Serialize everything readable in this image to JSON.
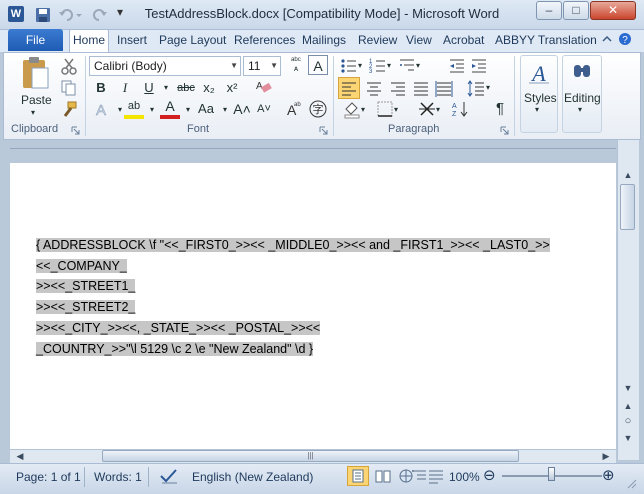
{
  "window": {
    "title": "TestAddressBlock.docx [Compatibility Mode]  -  Microsoft Word",
    "min_label": "–",
    "max_label": "□",
    "close_label": "✕"
  },
  "qat": {
    "word_logo_label": "W",
    "dropdown_label": "▾"
  },
  "tabs": {
    "file": "File",
    "home": "Home",
    "items": [
      "Insert",
      "Page Layout",
      "References",
      "Mailings",
      "Review",
      "View",
      "Acrobat",
      "ABBYY Translation"
    ]
  },
  "ribbon": {
    "clipboard": {
      "label": "Clipboard",
      "paste": "Paste"
    },
    "font": {
      "label": "Font",
      "font_name": "Calibri (Body)",
      "font_size": "11",
      "bold": "B",
      "italic": "I",
      "underline": "U",
      "strikethrough": "abc",
      "subscript": "x₂",
      "superscript": "x²",
      "grow": "A˄",
      "shrink": "A˅",
      "change_case": "Aa",
      "font_color_glyph": "A",
      "highlight_glyph": "ab"
    },
    "paragraph": {
      "label": "Paragraph",
      "pilcrow": "¶"
    },
    "styles": {
      "label": "Styles"
    },
    "editing": {
      "label": "Editing"
    }
  },
  "document": {
    "lines": [
      "{ ADDRESSBLOCK \\f \"<<_FIRST0_>><< _MIDDLE0_>><< and _FIRST1_>><< _LAST0_>>",
      "<<_COMPANY_",
      ">><<_STREET1_",
      ">><<_STREET2_",
      ">><<_CITY_>><<, _STATE_>><< _POSTAL_>><<",
      "_COUNTRY_>>\"\\l 5129 \\c 2 \\e \"New Zealand\" \\d }"
    ]
  },
  "status": {
    "page": "Page: 1 of 1",
    "words": "Words: 1",
    "language": "English (New Zealand)",
    "zoom": "100%",
    "zoom_out": "⊖",
    "zoom_in": "⊕"
  },
  "colors": {
    "file_tab": "#2a64bd",
    "highlight": "#c6c6c6",
    "active_button": "#fbd574"
  }
}
